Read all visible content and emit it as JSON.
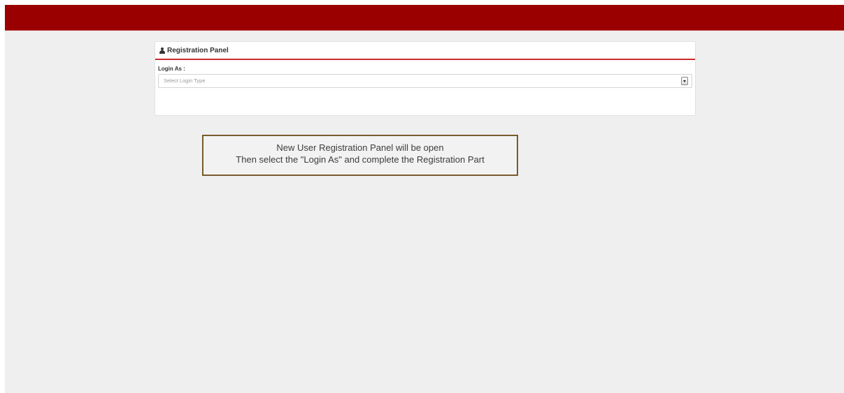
{
  "colors": {
    "top_bar": "#9b0000",
    "panel_accent": "#cc2b2b",
    "callout_border": "#7a5a2e",
    "page_background": "#efefef"
  },
  "panel": {
    "icon": "user-icon",
    "title": "Registration Panel",
    "login_as_label": "Login As :",
    "login_type_select": {
      "placeholder": "Select Login Type",
      "icon": "dropdown-arrow-icon"
    }
  },
  "callout": {
    "line1": "New User Registration Panel will be open",
    "line2": "Then select the \"Login As\" and complete the Registration Part"
  }
}
